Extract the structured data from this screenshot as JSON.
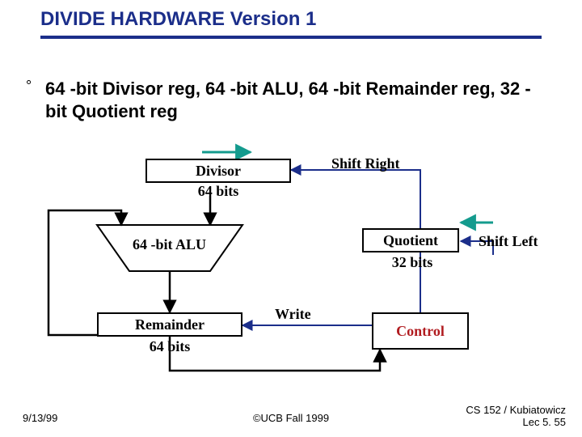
{
  "title": "DIVIDE HARDWARE Version 1",
  "bullet": "64 -bit Divisor reg, 64 -bit ALU, 64 -bit Remainder reg, 32 -bit Quotient reg",
  "bullet_marker": "°",
  "diagram": {
    "divisor": {
      "label": "Divisor",
      "bits": "64 bits",
      "shift": "Shift Right"
    },
    "alu": {
      "label": "64 -bit ALU"
    },
    "quotient": {
      "label": "Quotient",
      "bits": "32 bits",
      "shift": "Shift Left"
    },
    "remainder": {
      "label": "Remainder",
      "bits": "64 bits",
      "write": "Write"
    },
    "control": {
      "label": "Control"
    }
  },
  "footer": {
    "date": "9/13/99",
    "center": "©UCB Fall 1999",
    "course": "CS 152 / Kubiatowicz",
    "lec": "Lec 5. 55"
  }
}
